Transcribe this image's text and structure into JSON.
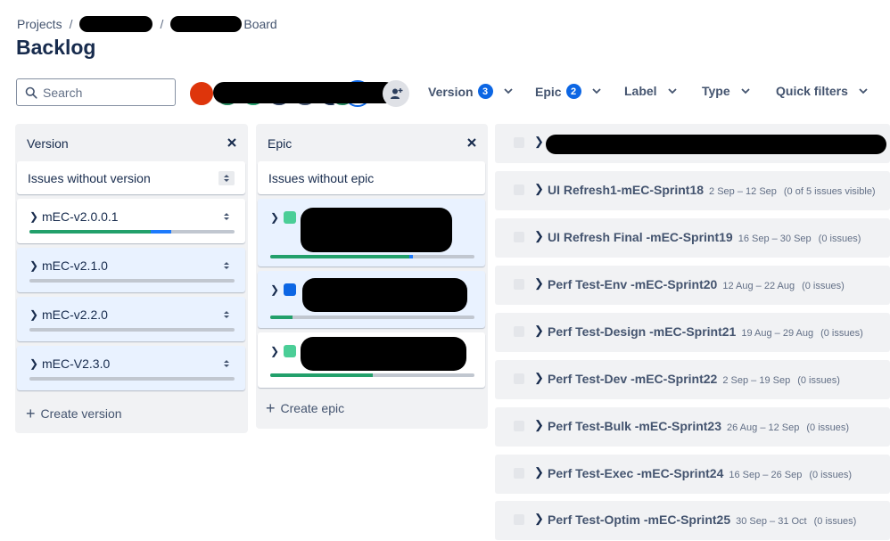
{
  "breadcrumb": {
    "projects": "Projects",
    "sep": "/",
    "board": "Board"
  },
  "page_title": "Backlog",
  "search": {
    "placeholder": "Search",
    "value": ""
  },
  "avatars": {
    "colors": [
      "#de350b",
      "#1f845a",
      "#22a06b",
      "#2c3e5d",
      "#44546f",
      "#172b4d",
      "#1f845a",
      "#0c66e4"
    ]
  },
  "filters": {
    "version": {
      "label": "Version",
      "count": "3"
    },
    "epic": {
      "label": "Epic",
      "count": "2"
    },
    "label": {
      "label": "Label"
    },
    "type": {
      "label": "Type"
    },
    "quick": {
      "label": "Quick filters"
    }
  },
  "version_panel": {
    "title": "Version",
    "without": "Issues without version",
    "items": [
      {
        "label": "mEC-v2.0.0.1",
        "done": 0.59,
        "in_progress": 0.1,
        "selected": false
      },
      {
        "label": "mEC-v2.1.0",
        "done": 0,
        "in_progress": 0,
        "selected": true
      },
      {
        "label": "mEC-v2.2.0",
        "done": 0,
        "in_progress": 0,
        "selected": true
      },
      {
        "label": "mEC-V2.3.0",
        "done": 0,
        "in_progress": 0,
        "selected": true
      }
    ],
    "create": "Create version"
  },
  "epic_panel": {
    "title": "Epic",
    "without": "Issues without epic",
    "items": [
      {
        "color": "#4bce97",
        "done": 0.68,
        "in_progress": 0.02,
        "selected": true
      },
      {
        "color": "#0c66e4",
        "done": 0.11,
        "in_progress": 0,
        "selected": true
      },
      {
        "color": "#4bce97",
        "done": 0.5,
        "in_progress": 0,
        "selected": false
      }
    ],
    "create": "Create epic"
  },
  "sprints": [
    {
      "name": "",
      "dates": "",
      "count": ""
    },
    {
      "name": "UI Refresh1-mEC-Sprint18",
      "dates": "2 Sep – 12 Sep",
      "count": "(0 of 5 issues visible)"
    },
    {
      "name": "UI Refresh Final -mEC-Sprint19",
      "dates": "16 Sep – 30 Sep",
      "count": "(0 issues)"
    },
    {
      "name": "Perf Test-Env -mEC-Sprint20",
      "dates": "12 Aug – 22 Aug",
      "count": "(0 issues)"
    },
    {
      "name": "Perf Test-Design -mEC-Sprint21",
      "dates": "19 Aug – 29 Aug",
      "count": "(0 issues)"
    },
    {
      "name": "Perf Test-Dev -mEC-Sprint22",
      "dates": "2 Sep – 19 Sep",
      "count": "(0 issues)"
    },
    {
      "name": "Perf Test-Bulk -mEC-Sprint23",
      "dates": "26 Aug – 12 Sep",
      "count": "(0 issues)"
    },
    {
      "name": "Perf Test-Exec -mEC-Sprint24",
      "dates": "16 Sep – 26 Sep",
      "count": "(0 issues)"
    },
    {
      "name": "Perf Test-Optim -mEC-Sprint25",
      "dates": "30 Sep – 31 Oct",
      "count": "(0 issues)"
    }
  ]
}
